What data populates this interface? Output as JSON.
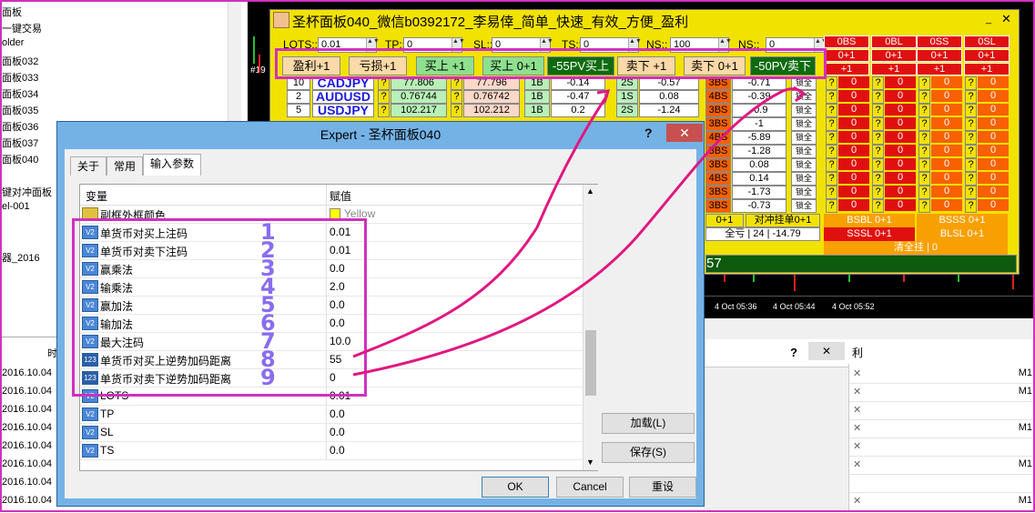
{
  "navigator": {
    "items": [
      "面板",
      "一键交易",
      "older",
      "面板032",
      "面板033",
      "面板034",
      "面板035",
      "面板036",
      "面板037",
      "面板040",
      "键对冲面板",
      "el-001",
      "器_2016"
    ]
  },
  "chart": {
    "time_labels": [
      "4 Oct 05:36",
      "4 Oct 05:44",
      "4 Oct 05:52"
    ],
    "left_tick": "#19"
  },
  "terminal": {
    "header_fragment": "时",
    "rows": [
      "2016.10.04",
      "2016.10.04",
      "2016.10.04",
      "2016.10.04",
      "2016.10.04",
      "2016.10.04",
      "2016.10.04",
      "2016.10.04"
    ]
  },
  "right_panel": {
    "question": "?",
    "close": "✕",
    "col_fragment": "利",
    "rows": [
      {
        "x": "✕",
        "m": "M1"
      },
      {
        "x": "✕",
        "m": "M1"
      },
      {
        "x": "✕",
        "m": ""
      },
      {
        "x": "✕",
        "m": "M1"
      },
      {
        "x": "✕",
        "m": ""
      },
      {
        "x": "✕",
        "m": "M1"
      },
      {
        "x": "",
        "m": ""
      },
      {
        "x": "✕",
        "m": "M1"
      }
    ]
  },
  "ea": {
    "title": "圣杯面板040_微信b0392172_李易倖_简单_快速_有效_方便_盈利",
    "inputs": [
      {
        "label": "LOTS::",
        "value": "0.01"
      },
      {
        "label": "TP::",
        "value": "0"
      },
      {
        "label": "SL::",
        "value": "0"
      },
      {
        "label": "TS::",
        "value": "0"
      },
      {
        "label": "NS::",
        "value": "100"
      },
      {
        "label": "NS::",
        "value": "0"
      }
    ],
    "buttons": [
      "盈利+1",
      "亏损+1",
      "买上 +1",
      "买上 0+1",
      "-55PV买上",
      "卖下 +1",
      "卖下 0+1",
      "-50PV卖下"
    ],
    "red_headers": [
      "0BS",
      "0BL",
      "0SS",
      "0SL"
    ],
    "red_row2": [
      "0+1",
      "0+1",
      "0+1",
      "0+1"
    ],
    "red_row3": [
      "+1",
      "+1",
      "+1",
      "+1"
    ],
    "rows": [
      {
        "n": "10",
        "sym": "CADJPY",
        "p1": "77.806",
        "p2": "77.796",
        "b": "1B",
        "bv": "-0.14",
        "s": "2S",
        "sv": "-0.57",
        "bs": "3BS",
        "bsv": "-0.71"
      },
      {
        "n": "2",
        "sym": "AUDUSD",
        "p1": "0.76744",
        "p2": "0.76742",
        "b": "1B",
        "bv": "-0.47",
        "s": "1S",
        "sv": "0.08",
        "bs": "4BS",
        "bsv": "-0.39"
      },
      {
        "n": "5",
        "sym": "USDJPY",
        "p1": "102.217",
        "p2": "102.212",
        "b": "1B",
        "bv": "0.2",
        "s": "2S",
        "sv": "-1.24",
        "bs": "3BS",
        "bsv": "-0.9"
      }
    ],
    "bsv_extra": [
      "-1",
      "-5.89",
      "-1.28",
      "0.08",
      "0.14",
      "-1.73",
      "-0.73"
    ],
    "lock_label": "锁全",
    "zero": "0",
    "q": "?",
    "bottom": {
      "left": "0+1",
      "hedge": "对冲挂单0+1",
      "bsbl": "BSBL 0+1",
      "bsss": "BSSS 0+1",
      "loss": "全亏 | 24 | -14.79",
      "sssl": "SSSL 0+1",
      "blsl": "BLSL 0+1",
      "clear": "清全挂 | 0",
      "status": "57"
    }
  },
  "dialog": {
    "title": "Expert - 圣杯面板040",
    "help": "?",
    "close": "✕",
    "tabs": [
      "关于",
      "常用",
      "输入参数"
    ],
    "col_var": "变量",
    "col_val": "赋值",
    "rows": [
      {
        "name": "副框外框颜色",
        "value": "Yellow",
        "icon": "color"
      },
      {
        "name": "单货币对买上注码",
        "value": "0.01",
        "icon": "V2"
      },
      {
        "name": "单货币对卖下注码",
        "value": "0.01",
        "icon": "V2"
      },
      {
        "name": "赢乘法",
        "value": "0.0",
        "icon": "V2"
      },
      {
        "name": "输乘法",
        "value": "2.0",
        "icon": "V2"
      },
      {
        "name": "赢加法",
        "value": "0.0",
        "icon": "V2"
      },
      {
        "name": "输加法",
        "value": "0.0",
        "icon": "V2"
      },
      {
        "name": "最大注码",
        "value": "10.0",
        "icon": "V2"
      },
      {
        "name": "单货币对买上逆势加码距离",
        "value": "55",
        "icon": "123"
      },
      {
        "name": "单货币对卖下逆势加码距离",
        "value": "0",
        "icon": "123"
      },
      {
        "name": "LOTS",
        "value": "0.01",
        "icon": "V2"
      },
      {
        "name": "TP",
        "value": "0.0",
        "icon": "V2"
      },
      {
        "name": "SL",
        "value": "0.0",
        "icon": "V2"
      },
      {
        "name": "TS",
        "value": "0.0",
        "icon": "V2"
      }
    ],
    "annot_numbers": [
      "1",
      "2",
      "3",
      "4",
      "5",
      "6",
      "7",
      "8",
      "9"
    ],
    "load_label": "加载(L)",
    "save_label": "保存(S)",
    "ok_label": "OK",
    "cancel_label": "Cancel",
    "reset_label": "重设"
  },
  "colors": {
    "ea_yellow": "#f2e200",
    "red": "#e01010",
    "orange": "#f86000",
    "annotation_magenta": "#d030c0",
    "dialog_blue": "#74b2e6"
  }
}
